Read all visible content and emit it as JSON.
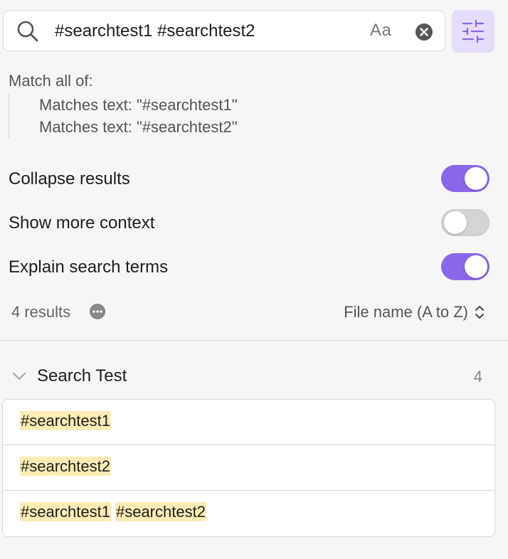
{
  "search": {
    "query": "#searchtest1 #searchtest2",
    "case_label": "Aa"
  },
  "explain": {
    "title": "Match all of:",
    "items": [
      "Matches text: \"#searchtest1\"",
      "Matches text: \"#searchtest2\""
    ]
  },
  "settings": [
    {
      "label": "Collapse results",
      "on": true
    },
    {
      "label": "Show more context",
      "on": false
    },
    {
      "label": "Explain search terms",
      "on": true
    }
  ],
  "results": {
    "count_label": "4 results",
    "sort_label": "File name (A to Z)"
  },
  "group": {
    "title": "Search Test",
    "count": "4",
    "matches": [
      [
        "#searchtest1"
      ],
      [
        "#searchtest2"
      ],
      [
        "#searchtest1",
        "#searchtest2"
      ]
    ]
  },
  "colors": {
    "accent": "#8a67e8",
    "accent_light": "#e6dcfb",
    "highlight": "#fdecb4"
  }
}
